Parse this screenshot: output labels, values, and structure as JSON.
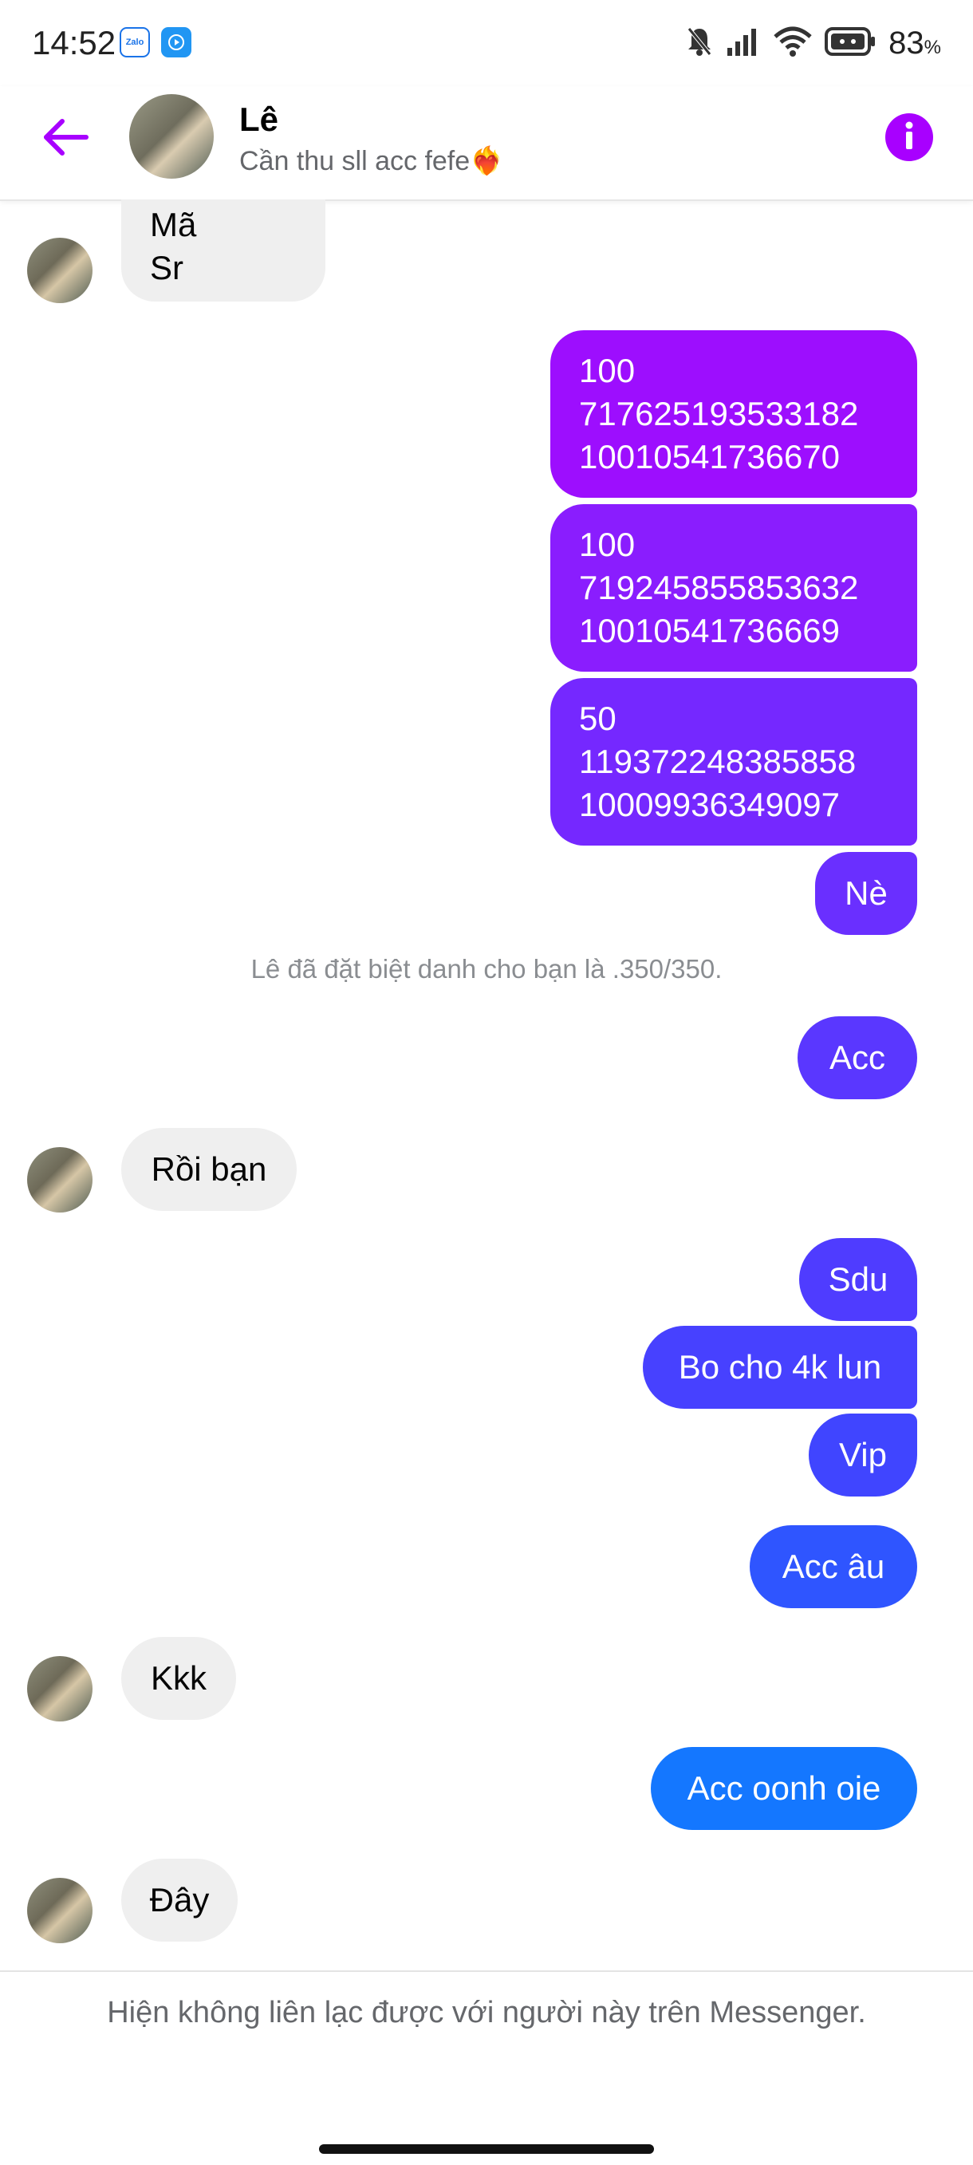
{
  "status_bar": {
    "time": "14:52",
    "battery_label": "83",
    "battery_unit": "%",
    "zalo_label": "Zalo",
    "icons": [
      "zalo-app-icon",
      "play-app-icon",
      "mute-bell-icon",
      "signal-icon",
      "wifi-icon",
      "battery-icon"
    ]
  },
  "header": {
    "name": "Lê",
    "status": "Cần thu sll acc fefe❤️‍🔥",
    "back_icon": "arrow-left-icon",
    "info_icon": "info-icon",
    "accent": "#a800ff"
  },
  "messages": {
    "m1_l1": "Mã",
    "m1_l2": "Sr",
    "m2_l1": "100",
    "m2_l2": "717625193533182",
    "m2_l3": "10010541736670",
    "m3_l1": "100",
    "m3_l2": "719245855853632",
    "m3_l3": "10010541736669",
    "m4_l1": "50",
    "m4_l2": "119372248385858",
    "m4_l3": "10009936349097",
    "m5": "Nè",
    "system_notice": "Lê đã đặt biệt danh cho bạn là .350/350.",
    "m6": "Acc",
    "m7": "Rồi bạn",
    "m8": "Sdu",
    "m9": "Bo cho 4k lun",
    "m10": "Vip",
    "m11": "Acc âu",
    "m12": "Kkk",
    "m13": "Acc oonh oie",
    "m14": "Đây"
  },
  "colors": {
    "incoming_bubble": "#efefef",
    "gradient_top": "#a20cff",
    "gradient_mid": "#6a33ff",
    "gradient_bottom": "#0b84ff"
  },
  "footer": {
    "notice": "Hiện không liên lạc được với người này trên Messenger."
  }
}
